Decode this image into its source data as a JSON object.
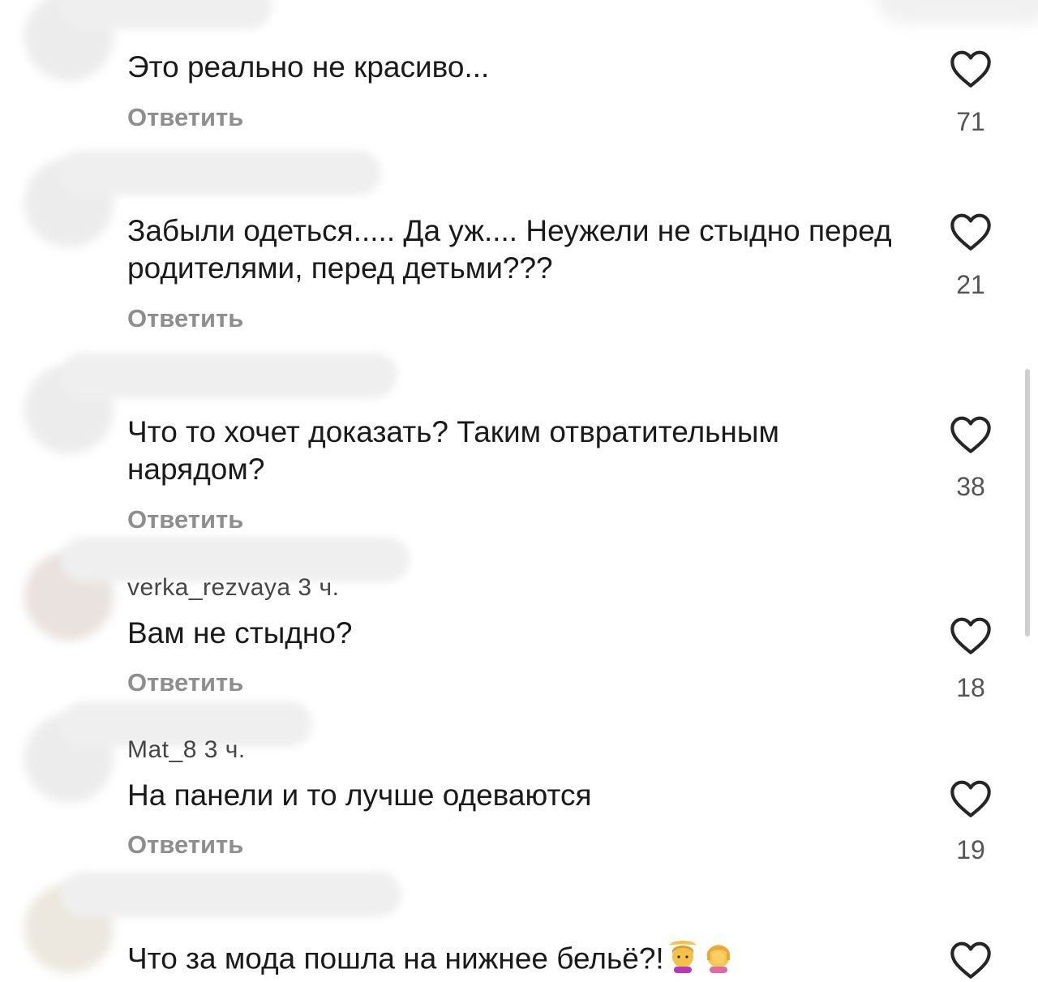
{
  "reply_label": "Ответить",
  "like_icon": "heart-outline-icon",
  "comments": [
    {
      "username": "",
      "text": "Это реально не красиво...",
      "likes": "71"
    },
    {
      "username": "",
      "text": "Забыли одеться..... Да уж.... Неужели не стыдно перед родителями, перед детьми???",
      "likes": "21"
    },
    {
      "username": "",
      "text": "Что то хочет доказать? Таким отвратительным нарядом?",
      "likes": "38"
    },
    {
      "username": "verka_rezvaya 3 ч.",
      "text": "Вам не стыдно?",
      "likes": "18"
    },
    {
      "username": "Mat_8 3 ч.",
      "text": "На панели и то лучше одеваются",
      "likes": "19"
    },
    {
      "username": "",
      "text": "Что за мода пошла на нижнее бельё?!",
      "emojis": [
        "woman-gesturing-ok-emoji",
        "woman-facepalming-emoji"
      ],
      "likes": ""
    }
  ]
}
